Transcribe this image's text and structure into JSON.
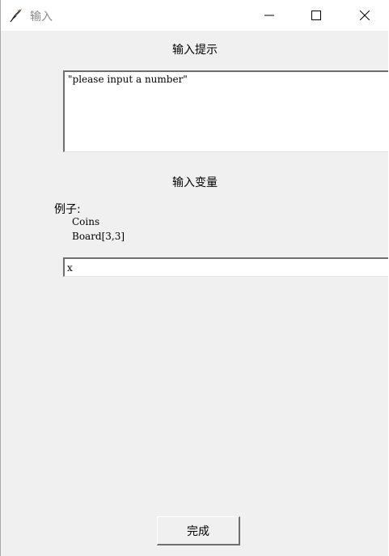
{
  "window": {
    "title": "输入",
    "icon": "feather-icon",
    "controls": {
      "minimize_icon": "minimize-icon",
      "maximize_icon": "maximize-icon",
      "close_icon": "close-icon"
    }
  },
  "prompt": {
    "heading": "输入提示",
    "text": "\"please input a number\""
  },
  "variable": {
    "heading": "输入变量",
    "example_label": "例子:",
    "examples": [
      "Coins",
      "Board[3,3]"
    ],
    "value": "x"
  },
  "actions": {
    "done_label": "完成"
  },
  "colors": {
    "window_bg": "#f0f0f0",
    "titlebar_bg": "#ffffff",
    "field_bg": "#ffffff",
    "title_text": "#8a8a8a"
  }
}
